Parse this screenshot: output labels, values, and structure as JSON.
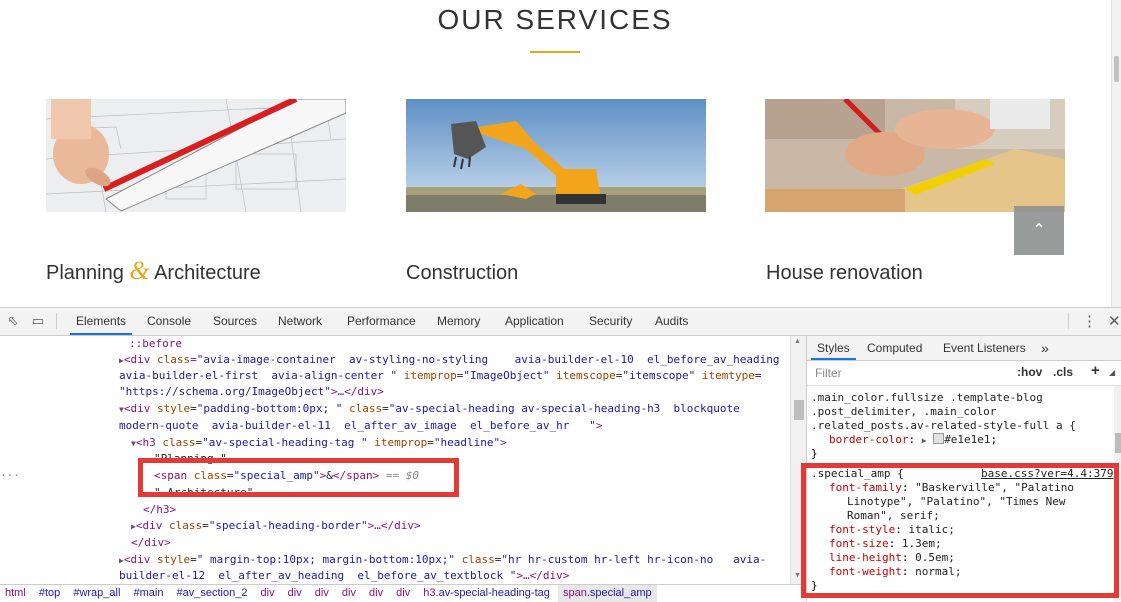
{
  "site": {
    "title": "OUR SERVICES",
    "services": [
      {
        "label_a": "Planning",
        "label_amp": "&",
        "label_b": "Architecture"
      },
      {
        "label": "Construction"
      },
      {
        "label": "House renovation"
      }
    ],
    "scroll_top_icon": "chevron-up-icon"
  },
  "devtools": {
    "tabs": [
      "Elements",
      "Console",
      "Sources",
      "Network",
      "Performance",
      "Memory",
      "Application",
      "Security",
      "Audits"
    ],
    "active_tab": "Elements",
    "elements": {
      "l1_tag": "div",
      "l1_attr": "class",
      "l1_val": "avia-image-container  av-styling-no-styling    avia-builder-el-10  el_before_av_heading",
      "l2_val": "avia-builder-el-first  avia-align-center ",
      "l2_attr2": "itemprop",
      "l2_val2": "ImageObject",
      "l2_attr3": "itemscope",
      "l2_val3": "itemscope",
      "l2_attr4": "itemtype",
      "l3_val": "https://schema.org/ImageObject",
      "l3_rest": ">…</div>",
      "l4_attr1": "style",
      "l4_val1": "padding-bottom:0px; ",
      "l4_attr2": "class",
      "l4_val2": "av-special-heading av-special-heading-h3  blockquote",
      "l5_val": "modern-quote  avia-builder-el-11  el_after_av_image  el_before_av_hr   ",
      "l6_tag": "h3",
      "l6_attr1": "class",
      "l6_val1": "av-special-heading-tag ",
      "l6_attr2": "itemprop",
      "l6_val2": "headline",
      "l7_text": "\"Planning \"",
      "l8_tag": "span",
      "l8_attr": "class",
      "l8_val": "special_amp",
      "l8_text": "&",
      "l8_suffix": " == $0",
      "l9_text": "\" Architecture\"",
      "l10_tag": "/h3",
      "l11_attr": "class",
      "l11_val": "special-heading-border",
      "l11_rest": ">…</div>",
      "l12_tag": "/div",
      "l13_attr1": "style",
      "l13_val1": " margin-top:10px; margin-bottom:10px;",
      "l13_attr2": "class",
      "l13_val2": "hr hr-custom hr-left hr-icon-no   avia-",
      "l14_val": "builder-el-12  el_after_av_heading  el_before_av_textblock ",
      "l14_rest": ">…</div>",
      "before_pseudo": "::before"
    },
    "breadcrumbs": [
      {
        "t": "html",
        "c": ""
      },
      {
        "t": "",
        "c": "#top"
      },
      {
        "t": "",
        "c": "#wrap_all"
      },
      {
        "t": "",
        "c": "#main"
      },
      {
        "t": "",
        "c": "#av_section_2"
      },
      {
        "t": "div",
        "c": ""
      },
      {
        "t": "div",
        "c": ""
      },
      {
        "t": "div",
        "c": ""
      },
      {
        "t": "div",
        "c": ""
      },
      {
        "t": "div",
        "c": ""
      },
      {
        "t": "div",
        "c": ""
      },
      {
        "t": "h3",
        "c": ".av-special-heading-tag"
      },
      {
        "t": "span",
        "c": ".special_amp"
      }
    ],
    "styles": {
      "tabs": [
        "Styles",
        "Computed",
        "Event Listeners"
      ],
      "more": "»",
      "filter_placeholder": "Filter",
      "hov": ":hov",
      "cls": ".cls",
      "plus": "+",
      "rule1_l1": ".main_color.fullsize .template-blog",
      "rule1_l2": ".post_delimiter, .main_color",
      "rule1_l3": ".related_posts.av-related-style-full a {",
      "rule1_prop": "border-color",
      "rule1_val": "#e1e1e1",
      "close": "}",
      "rule2_selector": ".special_amp {",
      "rule2_source": "base.css?ver=4.4:379",
      "rule2_props": [
        {
          "p": "font-family",
          "v": "\"Baskerville\", \"Palatino"
        },
        {
          "p": "",
          "v": "Linotype\", \"Palatino\", \"Times New"
        },
        {
          "p": "",
          "v": "Roman\", serif;"
        },
        {
          "p": "font-style",
          "v": "italic;"
        },
        {
          "p": "font-size",
          "v": "1.3em;"
        },
        {
          "p": "line-height",
          "v": "0.5em;"
        },
        {
          "p": "font-weight",
          "v": "normal;"
        }
      ]
    }
  },
  "colors": {
    "accent_gold": "#e6a817",
    "annotation_red": "#e53935",
    "devtools_blue": "#1a73e8",
    "tag_purple": "#881280",
    "attr_brown": "#994500",
    "value_blue": "#1a1aa6"
  }
}
